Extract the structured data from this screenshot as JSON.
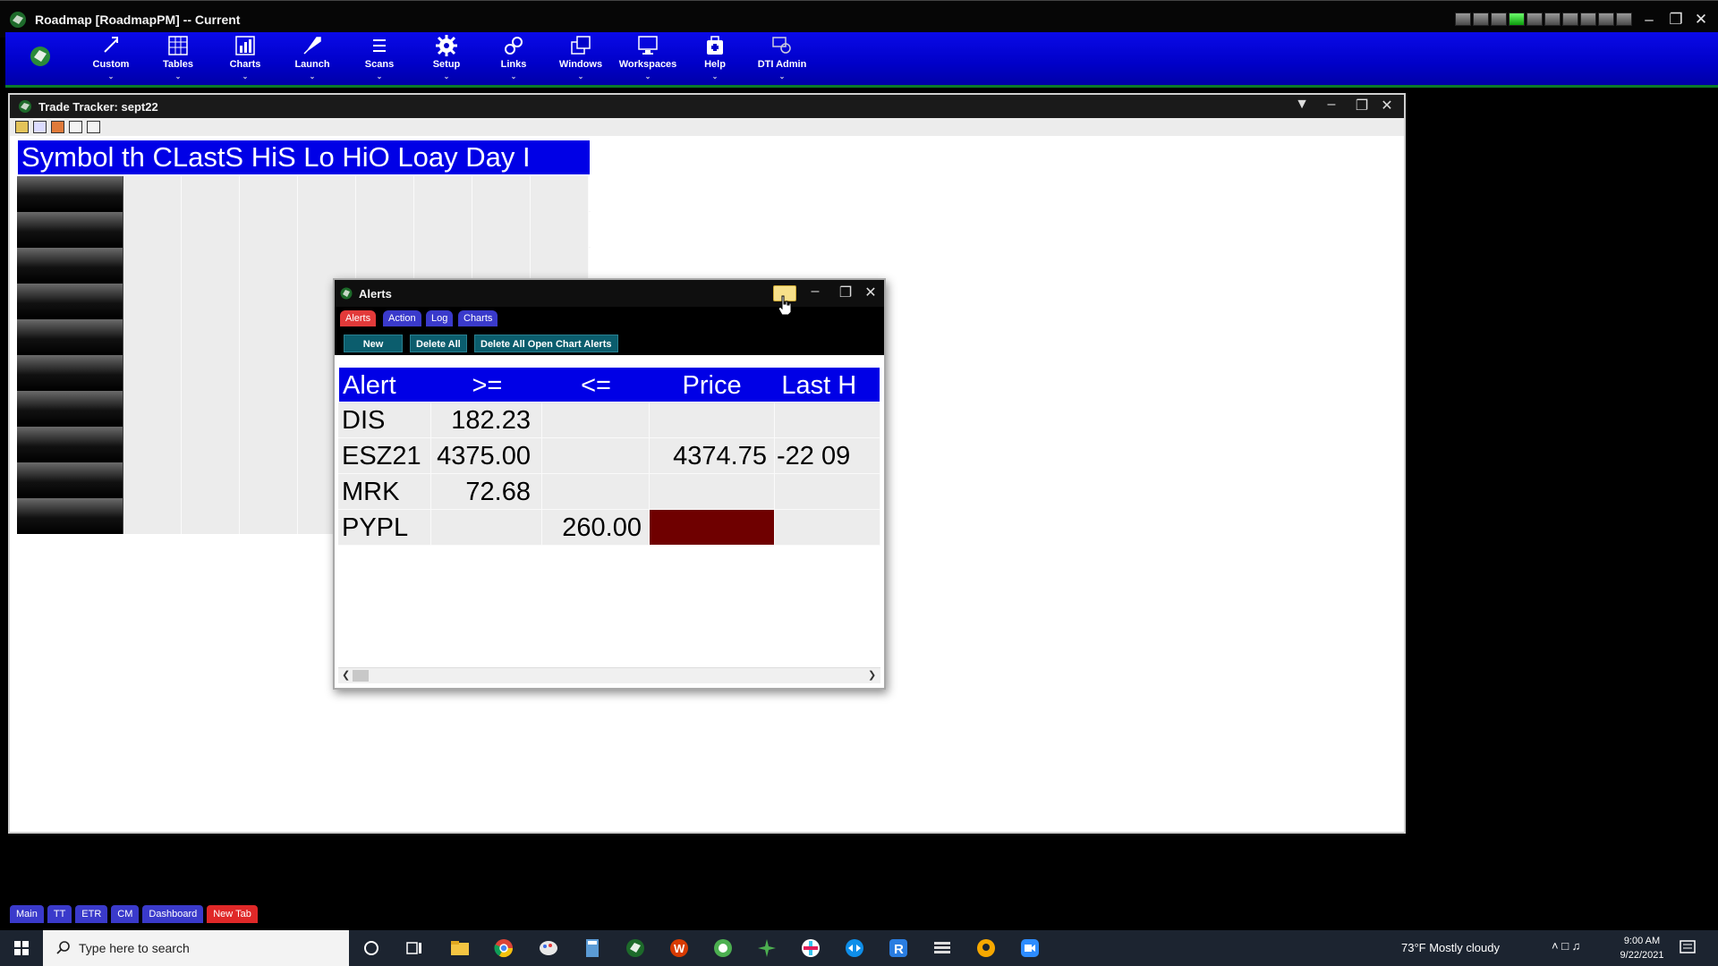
{
  "app": {
    "title": "Roadmap [RoadmapPM]  -- Current"
  },
  "toolbar": {
    "items": [
      {
        "label": "Custom",
        "icon": "custom-icon"
      },
      {
        "label": "Tables",
        "icon": "table-icon"
      },
      {
        "label": "Charts",
        "icon": "chart-icon"
      },
      {
        "label": "Launch",
        "icon": "rocket-icon"
      },
      {
        "label": "Scans",
        "icon": "list-icon"
      },
      {
        "label": "Setup",
        "icon": "gear-icon"
      },
      {
        "label": "Links",
        "icon": "link-icon"
      },
      {
        "label": "Windows",
        "icon": "windows-icon"
      },
      {
        "label": "Workspaces",
        "icon": "monitor-icon"
      },
      {
        "label": "Help",
        "icon": "help-icon"
      },
      {
        "label": "DTI Admin",
        "icon": "admin-icon"
      }
    ]
  },
  "trade_tracker": {
    "title": "Trade Tracker: sept22",
    "header_text": "Symbol th CLastS HiS Lo HiO Loay Day I"
  },
  "alerts": {
    "title": "Alerts",
    "tabs": [
      "Alerts",
      "Action",
      "Log",
      "Charts"
    ],
    "buttons": [
      "New",
      "Delete All",
      "Delete All Open Chart Alerts"
    ],
    "columns": [
      "Alert",
      ">=",
      "<=",
      "Price",
      "Last H"
    ],
    "rows": [
      {
        "alert": "DIS",
        "gte": "182.23",
        "lte": "",
        "price": "",
        "last": ""
      },
      {
        "alert": "ESZ21",
        "gte": "4375.00",
        "lte": "",
        "price": "4374.75",
        "last": "-22 09"
      },
      {
        "alert": "MRK",
        "gte": "72.68",
        "lte": "",
        "price": "",
        "last": ""
      },
      {
        "alert": "PYPL",
        "gte": "",
        "lte": "260.00",
        "price": "",
        "last": ""
      }
    ]
  },
  "workspace_tabs": [
    "Main",
    "TT",
    "ETR",
    "CM",
    "Dashboard",
    "New Tab"
  ],
  "taskbar": {
    "search_placeholder": "Type here to search",
    "weather": "73°F  Mostly cloudy",
    "time": "9:00 AM",
    "date": "9/22/2021"
  },
  "colors": {
    "toolbar_blue": "#0000d8",
    "header_blue": "#0000e6",
    "alert_hit": "#6f0000",
    "new_tab_red": "#e02828"
  }
}
